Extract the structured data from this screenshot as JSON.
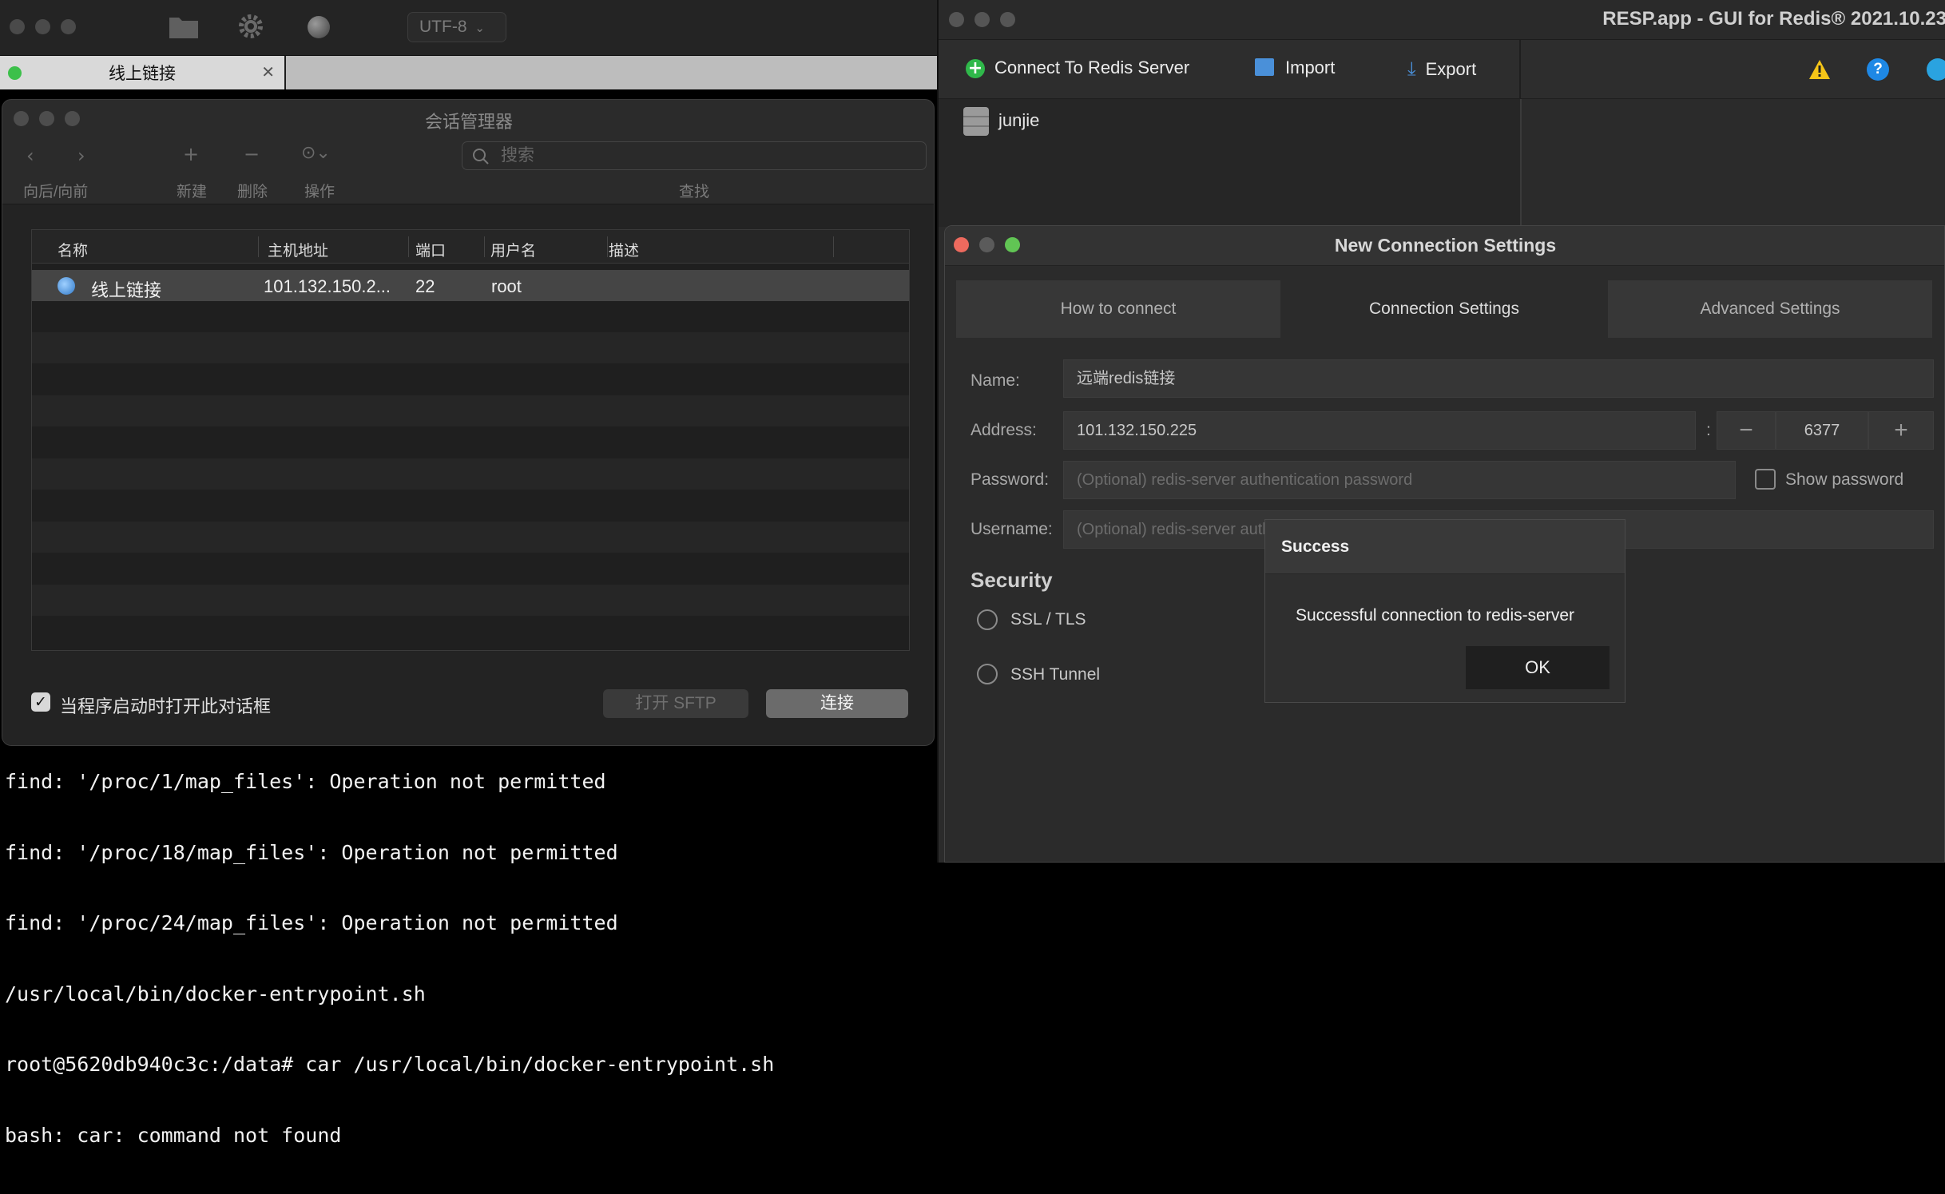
{
  "terminal": {
    "encoding": "UTF-8",
    "tab_title": "线上链接",
    "output_lines": [
      "find: '/proc/1/map_files': Operation not permitted",
      "find: '/proc/18/map_files': Operation not permitted",
      "find: '/proc/24/map_files': Operation not permitted",
      "/usr/local/bin/docker-entrypoint.sh",
      "root@5620db940c3c:/data# car /usr/local/bin/docker-entrypoint.sh",
      "bash: car: command not found"
    ]
  },
  "session_manager": {
    "title": "会话管理器",
    "toolbar": {
      "back_forward_label": "向后/向前",
      "new_label": "新建",
      "delete_label": "删除",
      "actions_label": "操作",
      "search_placeholder": "搜索",
      "search_label": "查找"
    },
    "columns": [
      "名称",
      "主机地址",
      "端口",
      "用户名",
      "描述"
    ],
    "rows": [
      {
        "name": "线上链接",
        "host": "101.132.150.2...",
        "port": "22",
        "user": "root",
        "desc": ""
      }
    ],
    "startup_checkbox_label": "当程序启动时打开此对话框",
    "startup_checked": true,
    "open_sftp_label": "打开 SFTP",
    "connect_label": "连接"
  },
  "resp": {
    "title": "RESP.app - GUI for Redis® 2021.10.23",
    "toolbar": {
      "connect_label": "Connect To Redis Server",
      "import_label": "Import",
      "export_label": "Export"
    },
    "connections": [
      "junjie"
    ],
    "dialog": {
      "title": "New Connection Settings",
      "tabs": [
        "How to connect",
        "Connection Settings",
        "Advanced Settings"
      ],
      "active_tab": "Connection Settings",
      "name_label": "Name:",
      "name_value": "远端redis链接",
      "address_label": "Address:",
      "address_value": "101.132.150.225",
      "port_value": "6377",
      "colon": ":",
      "password_label": "Password:",
      "password_placeholder": "(Optional) redis-server authentication password",
      "show_password_label": "Show password",
      "username_label": "Username:",
      "username_placeholder": "(Optional) redis-server authentication username",
      "security_title": "Security",
      "ssl_label": "SSL / TLS",
      "ssh_label": "SSH Tunnel"
    },
    "success": {
      "title": "Success",
      "message": "Successful connection to redis-server",
      "ok_label": "OK"
    }
  },
  "colors": {
    "traffic_red": "#ed6a5e",
    "traffic_yellow": "#5b5b5b",
    "traffic_green": "#61c554",
    "warning": "#f5c518",
    "help_blue": "#1e88e5"
  }
}
